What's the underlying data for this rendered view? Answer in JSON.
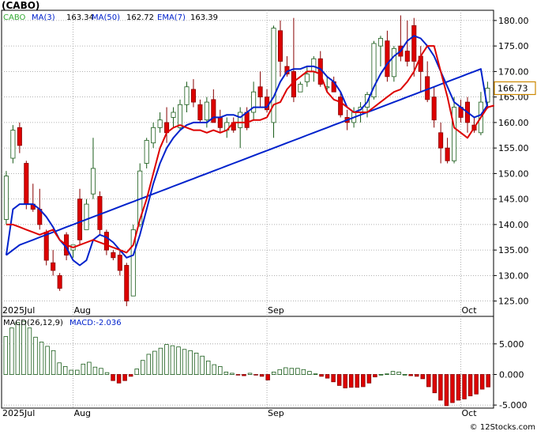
{
  "title": "(CABO)",
  "copyright": "© 12Stocks.com",
  "colors": {
    "up": "#33aa33",
    "down": "#dd0000",
    "ma3": "#dd0000",
    "ma50": "#0022cc",
    "ema7": "#0022cc",
    "hist_pos": "#1a5c1a",
    "hist_neg": "#dd0000",
    "last_price_box": "#cc8800"
  },
  "legend": {
    "ticker": "CABO",
    "ma3_label": "MA(3)",
    "ma3_value": "163.34",
    "ma50_label": "MA(50)",
    "ma50_value": "162.72",
    "ema7_label": "EMA(7)",
    "ema7_value": "163.39"
  },
  "macd_legend": {
    "label": "MACD(26,12,9)",
    "value_label": "MACD:-2.036"
  },
  "chart_data": [
    {
      "type": "candlestick",
      "ylim": [
        122,
        182
      ],
      "y_ticks": [
        "125.00",
        "130.00",
        "135.00",
        "140.00",
        "145.00",
        "150.00",
        "155.00",
        "160.00",
        "165.00",
        "170.00",
        "175.00",
        "180.00"
      ],
      "y_tick_values": [
        125,
        130,
        135,
        140,
        145,
        150,
        155,
        160,
        165,
        170,
        175,
        180
      ],
      "x_tick_labels": [
        "2025Jul",
        "Aug",
        "Sep",
        "Oct"
      ],
      "x_tick_index": [
        0,
        10,
        39,
        68
      ],
      "last_price": "166.73",
      "last_price_value": 166.73,
      "series": [
        {
          "name": "Price",
          "ohlc": [
            [
              141,
              150.5,
              140,
              149.5
            ],
            [
              153,
              159.5,
              152,
              158.5
            ],
            [
              159,
              160,
              154,
              155.5
            ],
            [
              152,
              152.5,
              143,
              144
            ],
            [
              144,
              148,
              142.5,
              143
            ],
            [
              143,
              147,
              139,
              140
            ],
            [
              138.5,
              139,
              132,
              133
            ],
            [
              132.5,
              135,
              130,
              131
            ],
            [
              130,
              130.5,
              127,
              127.5
            ],
            [
              138,
              138.5,
              133,
              134
            ],
            [
              135,
              136,
              133.5,
              136
            ],
            [
              145,
              147,
              136,
              137
            ],
            [
              139,
              145,
              139,
              144
            ],
            [
              146,
              157,
              145,
              151
            ],
            [
              145.5,
              146.5,
              138,
              139
            ],
            [
              138.5,
              139,
              134,
              135
            ],
            [
              134.5,
              135,
              133,
              133.5
            ],
            [
              134,
              135,
              130,
              131
            ],
            [
              132,
              132.5,
              124,
              125
            ],
            [
              126,
              140,
              126,
              139
            ],
            [
              140,
              152,
              139.5,
              150.5
            ],
            [
              152,
              157,
              151,
              156.5
            ],
            [
              156,
              160,
              155,
              159
            ],
            [
              159,
              162,
              158,
              160.5
            ],
            [
              160,
              163,
              156,
              158
            ],
            [
              161,
              163,
              159,
              162
            ],
            [
              159,
              164.5,
              158.5,
              163.5
            ],
            [
              163.5,
              168,
              162,
              167
            ],
            [
              166.5,
              168.5,
              163,
              164
            ],
            [
              163.5,
              164.5,
              160,
              160.5
            ],
            [
              160.5,
              165,
              159,
              164
            ],
            [
              164.5,
              166.5,
              160,
              160
            ],
            [
              161,
              162.5,
              158,
              159
            ],
            [
              158.5,
              161,
              157,
              160
            ],
            [
              160,
              161,
              158,
              158.5
            ],
            [
              159,
              163,
              155,
              162
            ],
            [
              162,
              163,
              158.5,
              159
            ],
            [
              162,
              168,
              160.5,
              166
            ],
            [
              167,
              170,
              163,
              165
            ],
            [
              165,
              166.5,
              162,
              162.5
            ],
            [
              160,
              179,
              157,
              178.5
            ],
            [
              178,
              180,
              169,
              172
            ],
            [
              171,
              173,
              169,
              169.5
            ],
            [
              170,
              180.5,
              164,
              165
            ],
            [
              166,
              168,
              166,
              167.5
            ],
            [
              168,
              171,
              167,
              169.5
            ],
            [
              170,
              173,
              168,
              172.5
            ],
            [
              172.5,
              174,
              167,
              167.5
            ],
            [
              167,
              169,
              166,
              167
            ],
            [
              168,
              169,
              166,
              166
            ],
            [
              165,
              166,
              161,
              161.5
            ],
            [
              161,
              162.5,
              158.5,
              160
            ],
            [
              160,
              163,
              159,
              162
            ],
            [
              162,
              164,
              160,
              163
            ],
            [
              163,
              166,
              161,
              165.5
            ],
            [
              165,
              176,
              164.5,
              175.5
            ],
            [
              175,
              177,
              171,
              176.5
            ],
            [
              176,
              178,
              168,
              169
            ],
            [
              169,
              175,
              168,
              174.5
            ],
            [
              175,
              181,
              172,
              173
            ],
            [
              174,
              180,
              171,
              172
            ],
            [
              179,
              180.5,
              169,
              172
            ],
            [
              173,
              175,
              166,
              170
            ],
            [
              169,
              172,
              164,
              164.5
            ],
            [
              165,
              167,
              159,
              160.5
            ],
            [
              158,
              160,
              152,
              155
            ],
            [
              155,
              157,
              152,
              152.5
            ],
            [
              152.5,
              165,
              152,
              163
            ],
            [
              163,
              164.5,
              160,
              161
            ],
            [
              164,
              165,
              158,
              160
            ],
            [
              159.5,
              161,
              158,
              158.5
            ],
            [
              158,
              166,
              157.5,
              164
            ],
            [
              164,
              168,
              163,
              166.73
            ]
          ]
        },
        {
          "name": "MA(3)",
          "values": [
            140,
            140,
            139.5,
            139,
            138.5,
            138,
            138.5,
            139,
            137,
            136,
            135.5,
            136,
            136.5,
            137,
            136.5,
            136,
            135.5,
            135,
            134.5,
            136,
            141,
            145,
            150,
            155,
            158,
            159,
            159.5,
            159,
            158.5,
            158.5,
            158,
            158.5,
            158,
            158.5,
            160,
            160,
            160,
            160.5,
            160.5,
            161,
            163.5,
            164,
            166.5,
            168,
            169,
            170,
            170,
            169.5,
            166,
            164.5,
            164,
            163,
            162,
            162,
            162,
            163,
            164,
            165,
            166,
            166.5,
            168,
            170,
            173,
            175,
            175,
            170,
            165,
            159,
            158,
            157,
            159,
            161,
            163,
            163.34
          ]
        },
        {
          "name": "MA(50)",
          "values": [
            134,
            135,
            136,
            136.5,
            137,
            137.5,
            138,
            138.5,
            139,
            139.5,
            140,
            140.5,
            141,
            141.5,
            142,
            142.5,
            143,
            143.5,
            144,
            144.5,
            145,
            145.5,
            146,
            146.5,
            147,
            147.5,
            148,
            148.5,
            149,
            149.5,
            150,
            150.5,
            151,
            151.5,
            152,
            152.5,
            153,
            153.5,
            154,
            154.5,
            155,
            155.5,
            156,
            156.5,
            157,
            157.5,
            158,
            158.5,
            159,
            159.5,
            160,
            160.5,
            161,
            161.5,
            162,
            162.5,
            163,
            163.5,
            164,
            164.5,
            165,
            165.5,
            166,
            166.5,
            167,
            167.5,
            168,
            168.5,
            169,
            169.5,
            170,
            170.5,
            162.72
          ]
        },
        {
          "name": "EMA(7)",
          "values": [
            134,
            143,
            144,
            144,
            144,
            143,
            141.5,
            139.5,
            137,
            135.5,
            133,
            132,
            133,
            137,
            138,
            137.5,
            136.5,
            135,
            133.5,
            134,
            138,
            143,
            148,
            152,
            155,
            157,
            158.5,
            159.5,
            160,
            160,
            160,
            161,
            161,
            161.5,
            161.5,
            161,
            162,
            163,
            163,
            163,
            165,
            168,
            170,
            170.5,
            170.5,
            171,
            171,
            170.5,
            169,
            168,
            166,
            163,
            162,
            162.5,
            164,
            167,
            169.5,
            171.5,
            173,
            174,
            176,
            177,
            176.5,
            175,
            173,
            170,
            167,
            164,
            163,
            162,
            161,
            161.5,
            163.39
          ]
        }
      ]
    },
    {
      "type": "bar",
      "title": "MACD(26,12,9)",
      "ylim": [
        -5.5,
        9.5
      ],
      "y_ticks": [
        "-5.000",
        "0.000",
        "5.000"
      ],
      "y_tick_values": [
        -5,
        0,
        5
      ],
      "x_tick_labels": [
        "2025Jul",
        "Aug",
        "Sep",
        "Oct"
      ],
      "x_tick_index": [
        0,
        10,
        39,
        68
      ],
      "series": [
        {
          "name": "MACD",
          "values": [
            6.2,
            7.6,
            8.5,
            8.7,
            7.6,
            6.1,
            5.3,
            4.6,
            3.9,
            1.9,
            1.3,
            0.7,
            0.7,
            1.7,
            2.0,
            1.2,
            1.0,
            0.3,
            -1.0,
            -1.4,
            -1.0,
            -0.3,
            0.9,
            2.3,
            3.3,
            3.8,
            4.3,
            4.9,
            4.7,
            4.5,
            4.1,
            3.9,
            3.5,
            3.0,
            2.2,
            1.6,
            1.3,
            0.4,
            0.2,
            -0.1,
            -0.2,
            0.2,
            -0.1,
            -0.3,
            -0.9,
            0.4,
            0.8,
            1.1,
            1.0,
            1.0,
            0.8,
            0.5,
            0.1,
            -0.3,
            -0.6,
            -1.2,
            -1.8,
            -2.2,
            -2.1,
            -2.1,
            -2.0,
            -1.4,
            -0.4,
            0.0,
            0.1,
            0.5,
            0.4,
            0.0,
            -0.2,
            -0.3,
            -0.7,
            -2.0,
            -3.0,
            -4.2,
            -5.1,
            -4.6,
            -4.2,
            -4.0,
            -3.5,
            -3.2,
            -2.4,
            -2.036
          ]
        }
      ]
    }
  ]
}
